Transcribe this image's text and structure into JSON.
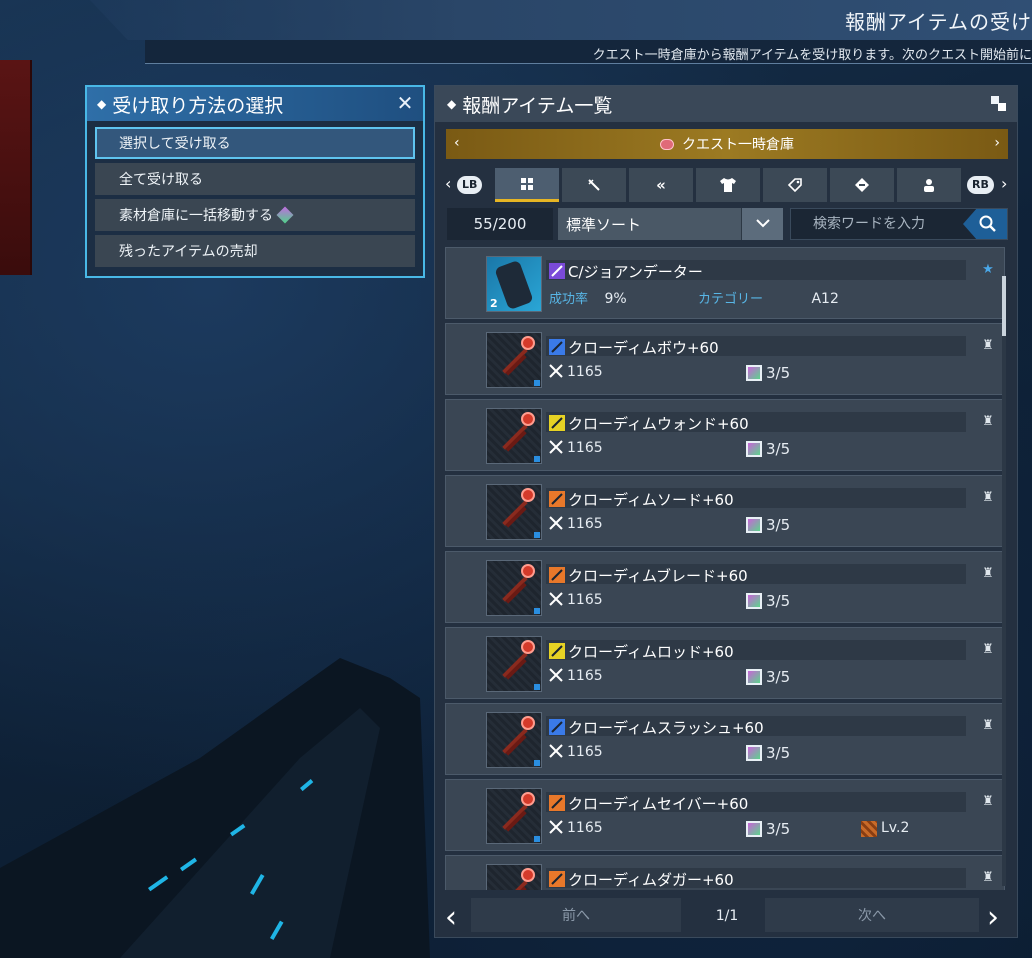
{
  "header": {
    "title": "報酬アイテムの受け",
    "subtitle": "クエスト一時倉庫から報酬アイテムを受け取ります。次のクエスト開始前に"
  },
  "receive_method": {
    "title": "受け取り方法の選択",
    "options": [
      {
        "label": "選択して受け取る",
        "selected": true
      },
      {
        "label": "全て受け取る"
      },
      {
        "label": "素材倉庫に一括移動する",
        "gem_icon": "purple-green-gem-icon"
      },
      {
        "label": "残ったアイテムの売却"
      }
    ]
  },
  "reward_list": {
    "title": "報酬アイテム一覧",
    "storage_label": "クエスト一時倉庫",
    "lb_label": "LB",
    "rb_label": "RB",
    "category_tabs": [
      {
        "icon": "all-grid-icon",
        "active": true
      },
      {
        "icon": "sword-icon"
      },
      {
        "icon": "twin-blades-icon"
      },
      {
        "icon": "armor-shirt-icon"
      },
      {
        "icon": "tag-icon"
      },
      {
        "icon": "material-icon"
      },
      {
        "icon": "robot-icon"
      }
    ],
    "count": "55/200",
    "sort_value": "標準ソート",
    "search_placeholder": "検索ワードを入力",
    "items": [
      {
        "name": "C/ジョアンデーター",
        "thumb_number": "2",
        "type_color": "#7a4ad8",
        "favorite": "blue",
        "success_label": "成功率",
        "success_value": "9%",
        "category_label": "カテゴリー",
        "category_value": "A12"
      },
      {
        "name": "クローディムボウ+60",
        "type_color": "#3a7ae8",
        "atk": "1165",
        "slots": "3/5"
      },
      {
        "name": "クローディムウォンド+60",
        "type_color": "#e6d224",
        "atk": "1165",
        "slots": "3/5"
      },
      {
        "name": "クローディムソード+60",
        "type_color": "#e8782a",
        "atk": "1165",
        "slots": "3/5"
      },
      {
        "name": "クローディムブレード+60",
        "type_color": "#e8782a",
        "atk": "1165",
        "slots": "3/5"
      },
      {
        "name": "クローディムロッド+60",
        "type_color": "#e6d224",
        "atk": "1165",
        "slots": "3/5"
      },
      {
        "name": "クローディムスラッシュ+60",
        "type_color": "#3a7ae8",
        "atk": "1165",
        "slots": "3/5"
      },
      {
        "name": "クローディムセイバー+60",
        "type_color": "#e8782a",
        "atk": "1165",
        "slots": "3/5",
        "level": "Lv.2"
      },
      {
        "name": "クローディムダガー+60",
        "type_color": "#e8782a"
      }
    ],
    "pager": {
      "prev_label": "前へ",
      "next_label": "次へ",
      "page": "1/1"
    }
  },
  "colors": {
    "accent_blue": "#49b8e6",
    "storage_gold": "#9c7a22",
    "active_tab_underline": "#e6b524"
  }
}
